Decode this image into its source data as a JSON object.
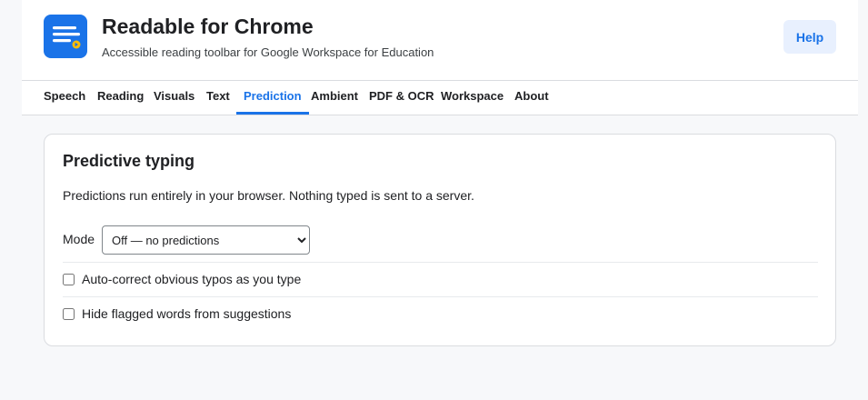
{
  "header": {
    "title": "Readable for Chrome",
    "subtitle": "Accessible reading toolbar for Google Workspace for Education",
    "help_label": "Help",
    "logo_icon": "document-lines-icon",
    "accent_color": "#1a73e8"
  },
  "tabs": [
    {
      "label": "Speech",
      "active": false
    },
    {
      "label": "Reading",
      "active": false
    },
    {
      "label": "Visuals",
      "active": false
    },
    {
      "label": "Text",
      "active": false
    },
    {
      "label": "Prediction",
      "active": true
    },
    {
      "label": "Ambient",
      "active": false
    },
    {
      "label": "PDF & OCR",
      "active": false
    },
    {
      "label": "Workspace",
      "active": false
    },
    {
      "label": "About",
      "active": false
    }
  ],
  "prediction": {
    "title": "Predictive typing",
    "description": "Predictions run entirely in your browser. Nothing typed is sent to a server.",
    "mode_label": "Mode",
    "mode_value": "Off — no predictions",
    "options": [
      {
        "label": "Auto-correct obvious typos as you type",
        "checked": false
      },
      {
        "label": "Hide flagged words from suggestions",
        "checked": false
      }
    ]
  }
}
